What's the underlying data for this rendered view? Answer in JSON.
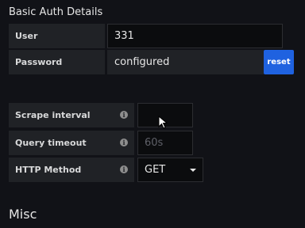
{
  "auth": {
    "section_title": "Basic Auth Details",
    "user": {
      "label": "User",
      "value": "331"
    },
    "password": {
      "label": "Password",
      "value": "configured",
      "reset_label": "reset"
    }
  },
  "settings": {
    "scrape_interval": {
      "label": "Scrape interval",
      "value": "",
      "info_icon": "info-icon"
    },
    "query_timeout": {
      "label": "Query timeout",
      "placeholder": "60s",
      "info_icon": "info-icon"
    },
    "http_method": {
      "label": "HTTP Method",
      "value": "GET",
      "info_icon": "info-icon"
    }
  },
  "misc": {
    "section_title": "Misc"
  },
  "colors": {
    "background": "#111217",
    "label_bg": "#202226",
    "input_bg": "#0b0c0e",
    "accent": "#1f62e0"
  }
}
